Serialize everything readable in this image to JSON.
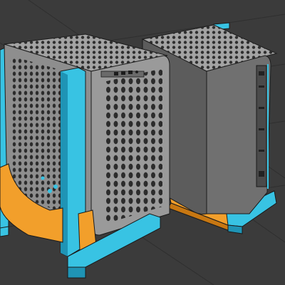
{
  "viewport": {
    "background": "#3b3b3b",
    "grid_color": "#2e2e2e"
  },
  "colors": {
    "stand_cyan": "#38c3e3",
    "stand_cyan_dark": "#1f94b5",
    "cradle_orange": "#f29f2b",
    "cradle_orange_dark": "#c77712",
    "case_grey": "#8e8e8e",
    "case_grey_dark": "#5c5c5c",
    "case_top": "#a3a3a3",
    "edge_dark": "#1a1a1a",
    "hole_dark": "#2b2b2b"
  },
  "objects": [
    {
      "name": "pc-case-front-view",
      "icon": "computer-case-icon"
    },
    {
      "name": "pc-case-rear-view",
      "icon": "computer-case-icon"
    }
  ]
}
